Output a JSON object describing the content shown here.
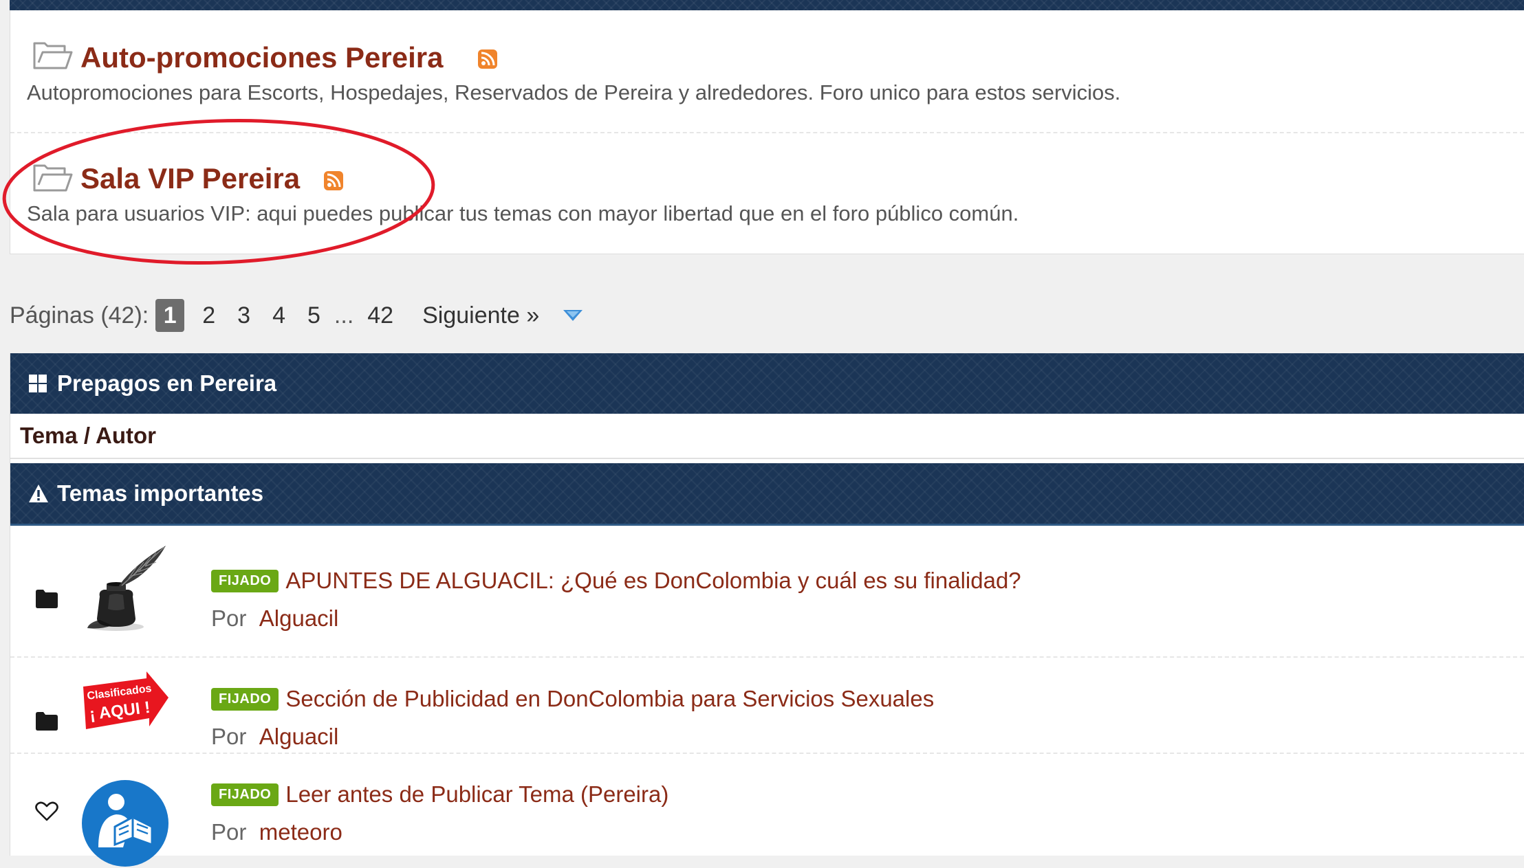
{
  "forums": [
    {
      "title": "Auto-promociones Pereira",
      "description": "Autopromociones para Escorts, Hospedajes, Reservados de Pereira y alrededores. Foro unico para estos servicios."
    },
    {
      "title": "Sala VIP Pereira",
      "description": "Sala para usuarios VIP: aqui puedes publicar tus temas con mayor libertad que en el foro público común."
    }
  ],
  "pagination": {
    "label": "Páginas (42):",
    "current": "1",
    "pages": [
      "2",
      "3",
      "4",
      "5"
    ],
    "dots": "...",
    "last": "42",
    "next": "Siguiente »"
  },
  "category": {
    "title": "Prepagos en Pereira",
    "column_header": "Tema / Autor",
    "important_header": "Temas importantes"
  },
  "threads": [
    {
      "badge": "FIJADO",
      "title": "APUNTES DE ALGUACIL: ¿Qué es DonColombia y cuál es su finalidad?",
      "by_label": "Por",
      "author": "Alguacil",
      "status_icon": "folder-icon"
    },
    {
      "badge": "FIJADO",
      "title": "Sección de Publicidad en DonColombia para Servicios Sexuales",
      "by_label": "Por",
      "author": "Alguacil",
      "avatar_text_1": "Clasificados",
      "avatar_text_2": "¡ AQUI !",
      "status_icon": "folder-icon"
    },
    {
      "badge": "FIJADO",
      "title": "Leer antes de Publicar Tema (Pereira)",
      "by_label": "Por",
      "author": "meteoro",
      "status_icon": "heart-icon"
    }
  ],
  "colors": {
    "title_red": "#8b2b17",
    "header_navy": "#1b3556",
    "badge_green": "#6aa815",
    "rss_orange": "#f0842c",
    "annotation_red": "#e01b2a"
  }
}
